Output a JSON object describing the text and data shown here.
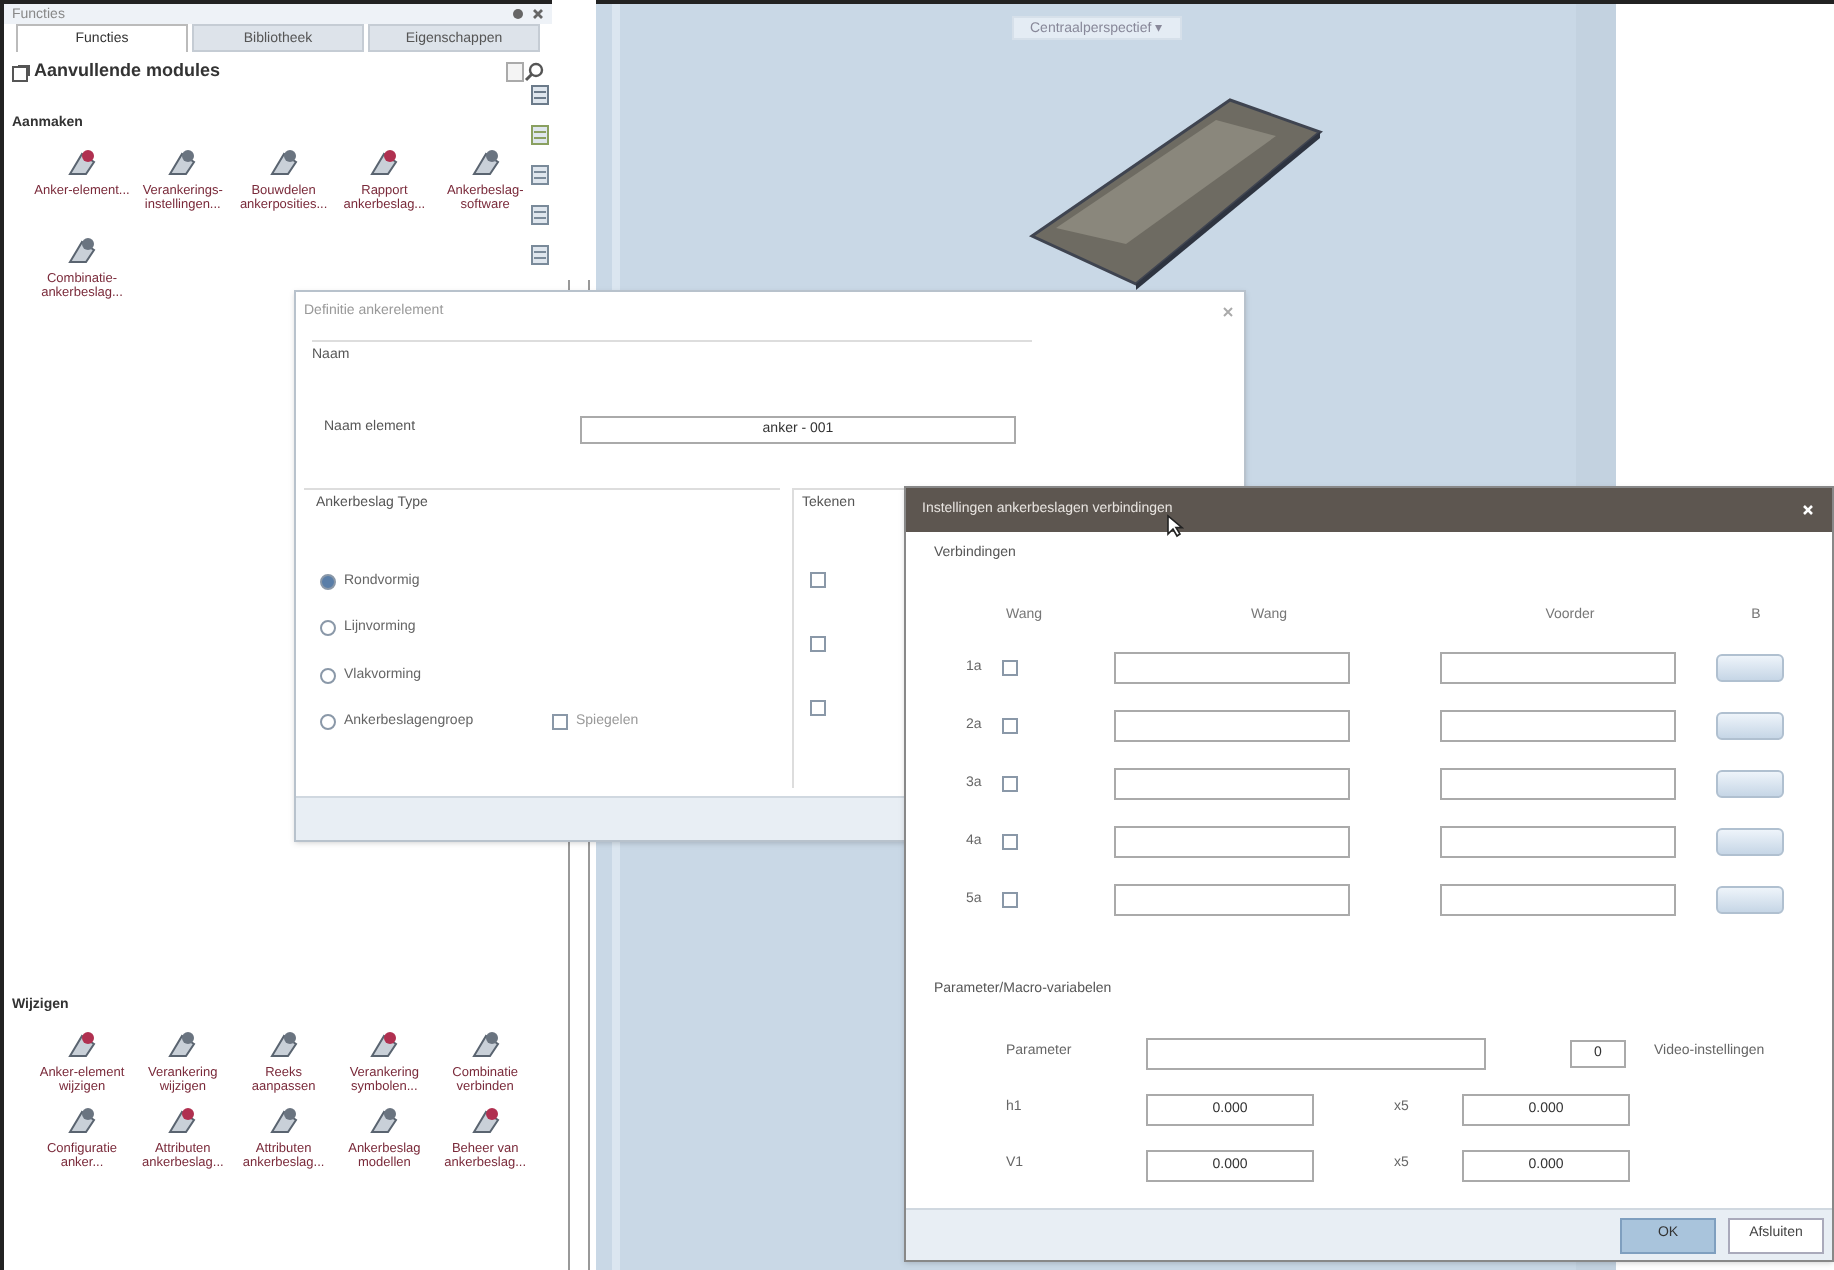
{
  "panel": {
    "title": "Functies",
    "tabs": [
      {
        "label": "Functies",
        "selected": true
      },
      {
        "label": "Bibliotheek",
        "selected": false
      },
      {
        "label": "Eigenschappen",
        "selected": false
      }
    ],
    "module": "Aanvullende modules",
    "sections": [
      {
        "title": "Aanmaken",
        "items": [
          {
            "label": "Anker-element..."
          },
          {
            "label": "Verankerings-\ninstellingen..."
          },
          {
            "label": "Bouwdelen\nankerposities..."
          },
          {
            "label": "Rapport\nankerbeslag..."
          },
          {
            "label": "Ankerbeslag-\nsoftware"
          },
          {
            "label": "Combinatie-\nankerbeslag..."
          }
        ]
      },
      {
        "title": "Wijzigen",
        "items": [
          {
            "label": "Anker-element\nwijzigen"
          },
          {
            "label": "Verankering\nwijzigen"
          },
          {
            "label": "Reeks\naanpassen"
          },
          {
            "label": "Verankering\nsymbolen..."
          },
          {
            "label": "Combinatie\nverbinden"
          },
          {
            "label": "Configuratie\nanker..."
          },
          {
            "label": "Attributen\nankerbeslag..."
          },
          {
            "label": "Attributen\nankerbeslag..."
          },
          {
            "label": "Ankerbeslag\nmodellen"
          },
          {
            "label": "Beheer van\nankerbeslag..."
          }
        ]
      }
    ]
  },
  "viewport": {
    "view_label": "Centraalperspectief ▾"
  },
  "dialog1": {
    "title": "Definitie ankerelement",
    "name_group": "Naam",
    "name_label": "Naam element",
    "name_value": "anker - 001",
    "type_group": "Ankerbeslag Type",
    "types": [
      {
        "label": "Rondvormig",
        "selected": true
      },
      {
        "label": "Lijnvorming",
        "selected": false
      },
      {
        "label": "Vlakvorming",
        "selected": false
      },
      {
        "label": "Ankerbeslagengroep",
        "selected": false,
        "option": {
          "label": "Spiegelen",
          "checked": false
        }
      }
    ],
    "draw_group": "Tekenen",
    "draw_checks": [
      {
        "checked": false
      },
      {
        "checked": false
      },
      {
        "checked": false
      }
    ]
  },
  "dialog2": {
    "title": "Instellingen ankerbeslagen verbindingen",
    "group": "Verbindingen",
    "headers": [
      "Wang",
      "Wang",
      "Voorder",
      "B"
    ],
    "rows": [
      {
        "label": "1a",
        "checked": false
      },
      {
        "label": "2a",
        "checked": false
      },
      {
        "label": "3a",
        "checked": false
      },
      {
        "label": "4a",
        "checked": false
      },
      {
        "label": "5a",
        "checked": false
      }
    ],
    "param_group": "Parameter/Macro-variabelen",
    "param_label": "Parameter",
    "param_count": "0",
    "param_note": "Video-instellingen",
    "values": [
      {
        "label": "h1",
        "value": "0.000",
        "label2": "x5",
        "value2": "0.000"
      },
      {
        "label": "V1",
        "value": "0.000",
        "label2": "x5",
        "value2": "0.000"
      }
    ],
    "buttons": [
      "OK",
      "Afsluiten"
    ]
  }
}
